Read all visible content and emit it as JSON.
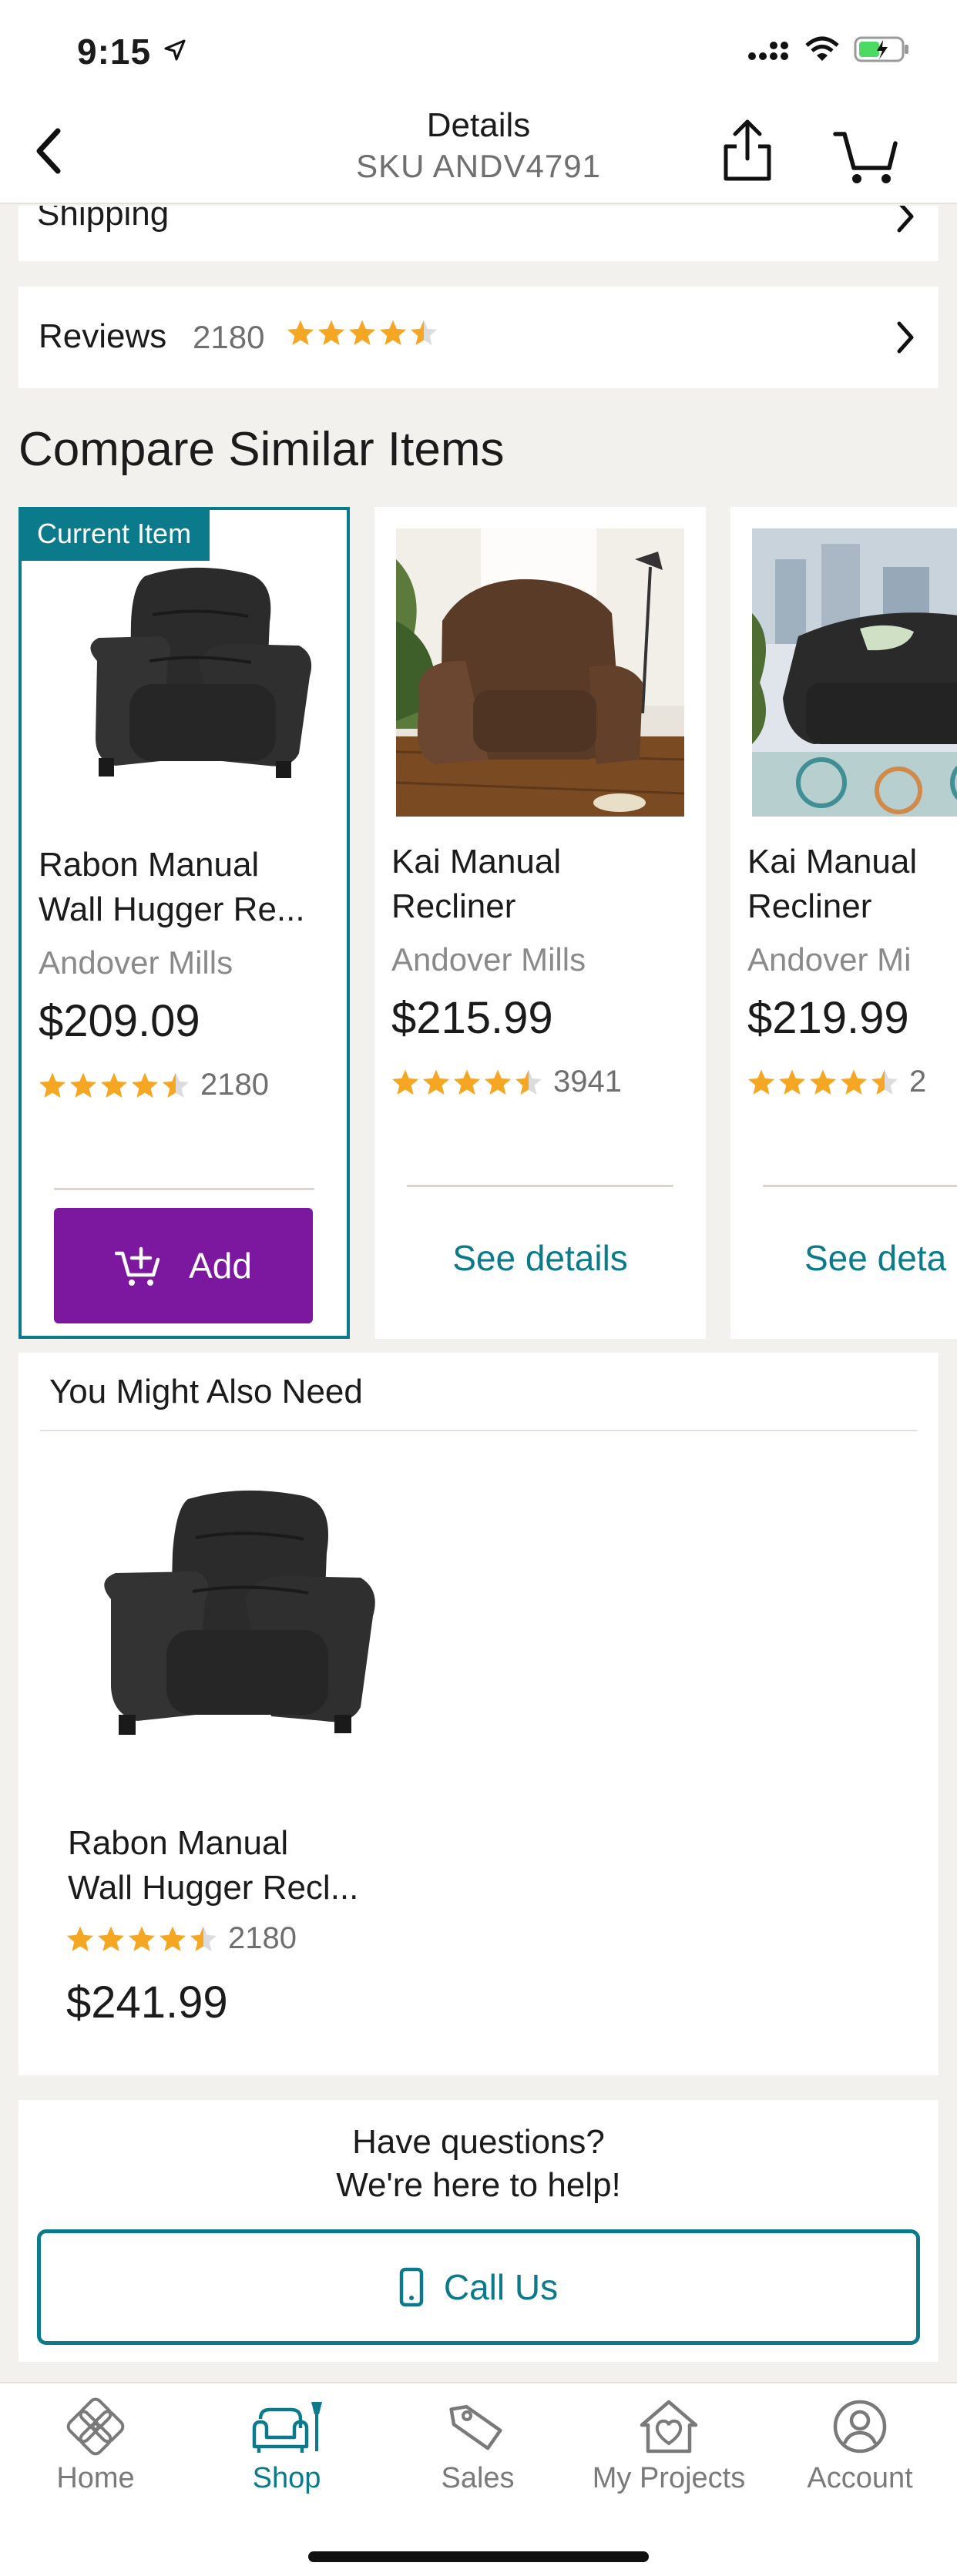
{
  "status_bar": {
    "time": "9:15"
  },
  "header": {
    "title": "Details",
    "subtitle": "SKU ANDV4791"
  },
  "shipping": {
    "label": "Shipping"
  },
  "reviews": {
    "label": "Reviews",
    "count": "2180",
    "rating": 4.5
  },
  "compare": {
    "title": "Compare Similar Items",
    "current_tag": "Current Item",
    "items": [
      {
        "name_line1": "Rabon Manual",
        "name_line2": "Wall Hugger Re...",
        "brand": "Andover Mills",
        "price": "$209.09",
        "rating": 4.5,
        "review_count": "2180",
        "action": "Add",
        "image": "black recliner chair"
      },
      {
        "name_line1": "Kai Manual",
        "name_line2": "Recliner",
        "brand": "Andover Mills",
        "price": "$215.99",
        "rating": 4.5,
        "review_count": "3941",
        "action": "See details",
        "image": "brown recliner chair"
      },
      {
        "name_line1": "Kai Manual",
        "name_line2": "Recliner",
        "brand": "Andover Mi",
        "price": "$219.99",
        "rating": 4.5,
        "review_count": "2",
        "action": "See deta",
        "image": "black leather recliner"
      }
    ]
  },
  "also_need": {
    "title": "You Might Also Need",
    "item": {
      "name_line1": "Rabon Manual",
      "name_line2": "Wall Hugger Recl...",
      "rating": 4.5,
      "review_count": "2180",
      "price": "$241.99",
      "image": "black recliner chair"
    }
  },
  "help": {
    "line1": "Have questions?",
    "line2": "We're here to help!",
    "call_label": "Call Us"
  },
  "tabs": [
    {
      "label": "Home",
      "icon": "home-icon",
      "active": false
    },
    {
      "label": "Shop",
      "icon": "shop-icon",
      "active": true
    },
    {
      "label": "Sales",
      "icon": "tag-icon",
      "active": false
    },
    {
      "label": "My Projects",
      "icon": "projects-icon",
      "active": false
    },
    {
      "label": "Account",
      "icon": "account-icon",
      "active": false
    }
  ],
  "colors": {
    "accent": "#0b7a8a",
    "purple": "#7b189f",
    "star": "#f5a623",
    "background": "#f3f1ee"
  }
}
